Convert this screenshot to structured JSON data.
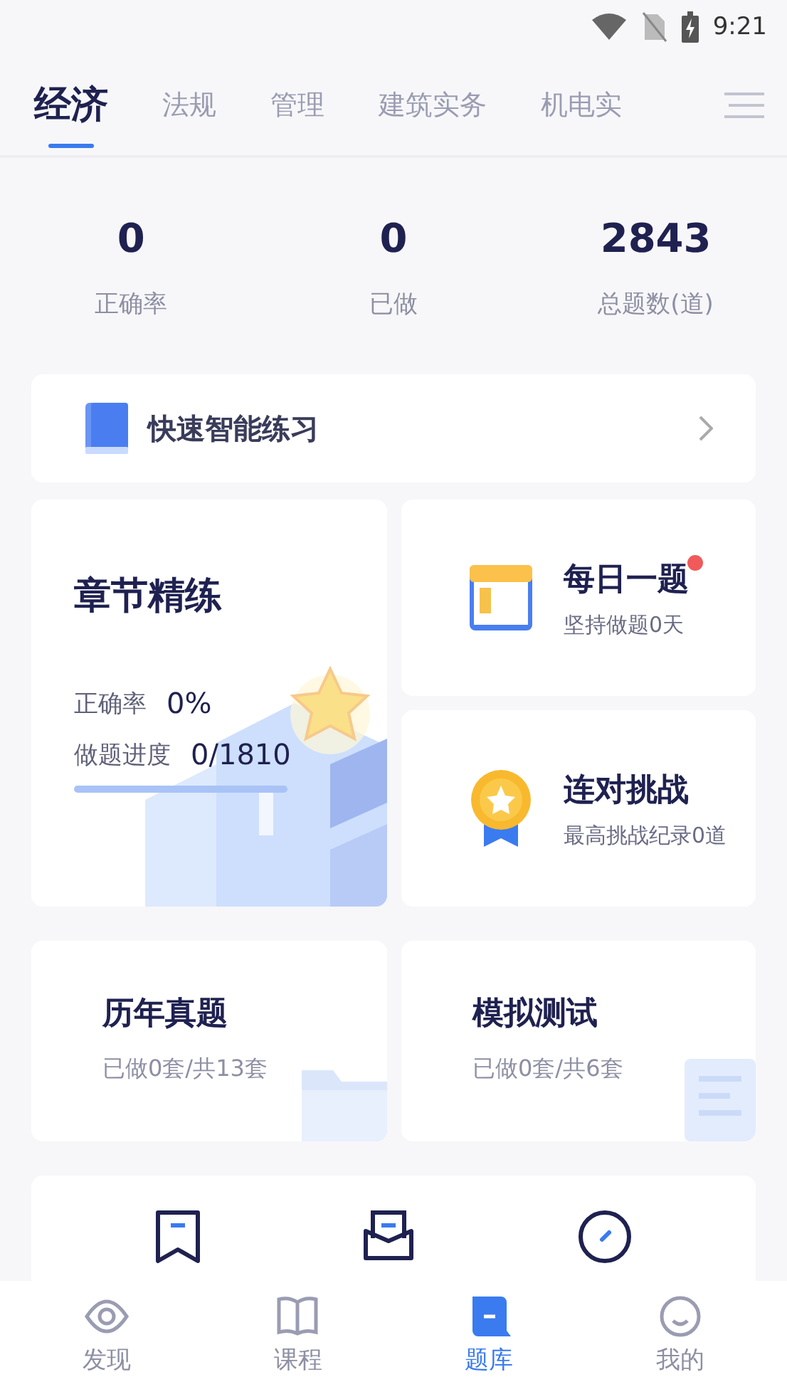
{
  "status_bar": {
    "time": "9:21"
  },
  "tabs": [
    {
      "label": "经济",
      "selected": true
    },
    {
      "label": "法规",
      "selected": false
    },
    {
      "label": "管理",
      "selected": false
    },
    {
      "label": "建筑实务",
      "selected": false
    },
    {
      "label": "机电实",
      "selected": false
    }
  ],
  "stats": [
    {
      "value": "0",
      "label": "正确率"
    },
    {
      "value": "0",
      "label": "已做"
    },
    {
      "value": "2843",
      "label": "总题数(道)"
    }
  ],
  "quick_practice": {
    "label": "快速智能练习"
  },
  "chapter_card": {
    "title": "章节精练",
    "accuracy_label": "正确率",
    "accuracy": "0%",
    "progress_label": "做题进度",
    "progress": "0/1810",
    "level": 0
  },
  "daily_card": {
    "title": "每日一题",
    "subtitle": "坚持做题0天",
    "badge": true
  },
  "streak_card": {
    "title": "连对挑战",
    "subtitle": "最高挑战纪录0道"
  },
  "exam_cards": [
    {
      "title": "历年真题",
      "subtitle": "已做0套/共13套"
    },
    {
      "title": "模拟测试",
      "subtitle": "已做0套/共6套"
    }
  ],
  "nav": [
    {
      "label": "发现",
      "selected": false
    },
    {
      "label": "课程",
      "selected": false
    },
    {
      "label": "题库",
      "selected": true
    },
    {
      "label": "我的",
      "selected": false
    }
  ]
}
